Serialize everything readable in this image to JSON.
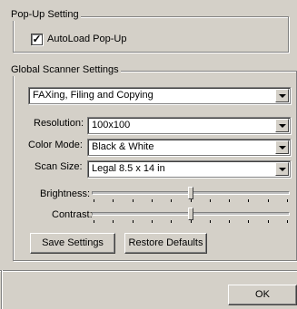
{
  "popup_group": {
    "title": "Pop-Up Setting",
    "autoload_label": "AutoLoad Pop-Up",
    "autoload_checked": true,
    "check_glyph": "✓"
  },
  "scanner_group": {
    "title": "Global Scanner Settings",
    "profile_value": "FAXing, Filing and Copying",
    "resolution_label": "Resolution:",
    "resolution_value": "100x100",
    "color_mode_label": "Color Mode:",
    "color_mode_value": "Black & White",
    "scan_size_label": "Scan Size:",
    "scan_size_value": "Legal 8.5 x 14 in",
    "brightness_label": "Brightness:",
    "brightness_level": 0.5,
    "contrast_label": "Contrast:",
    "contrast_level": 0.5,
    "save_label": "Save Settings",
    "restore_label": "Restore Defaults"
  },
  "footer": {
    "ok_label": "OK"
  }
}
